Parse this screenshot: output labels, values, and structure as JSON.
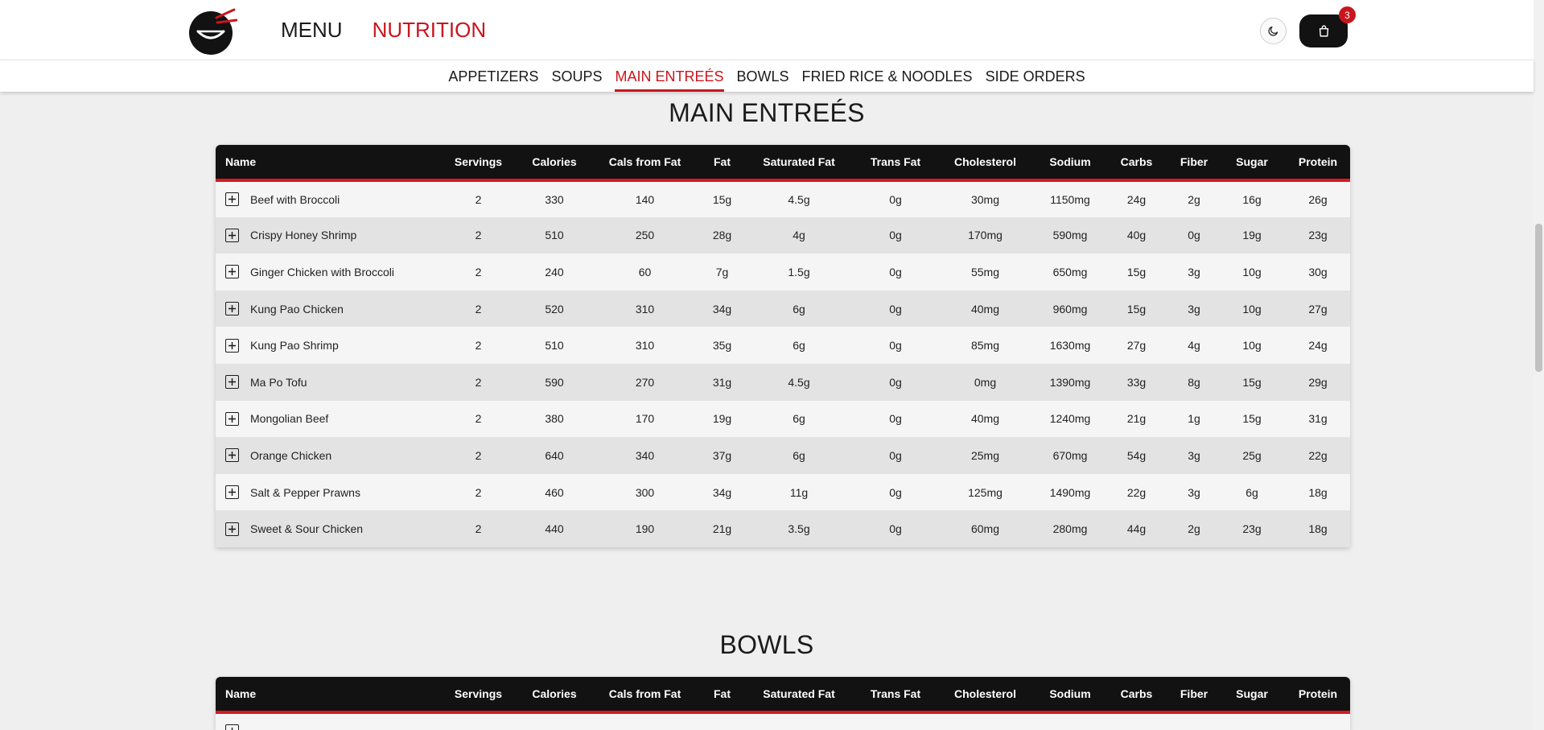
{
  "header": {
    "logo_icon": "bowl-chopsticks-logo",
    "nav": [
      {
        "label": "MENU",
        "active": false
      },
      {
        "label": "NUTRITION",
        "active": true
      }
    ],
    "theme_icon": "moon-icon",
    "cart_icon": "shopping-bag-icon",
    "cart_count": "3"
  },
  "subnav": [
    {
      "label": "APPETIZERS",
      "active": false
    },
    {
      "label": "SOUPS",
      "active": false
    },
    {
      "label": "MAIN ENTREÉS",
      "active": true
    },
    {
      "label": "BOWLS",
      "active": false
    },
    {
      "label": "FRIED RICE & NOODLES",
      "active": false
    },
    {
      "label": "SIDE ORDERS",
      "active": false
    }
  ],
  "columns": [
    "Name",
    "Servings",
    "Calories",
    "Cals from Fat",
    "Fat",
    "Saturated Fat",
    "Trans Fat",
    "Cholesterol",
    "Sodium",
    "Carbs",
    "Fiber",
    "Sugar",
    "Protein"
  ],
  "sections": [
    {
      "title": "MAIN ENTREÉS",
      "rows": [
        [
          "Beef with Broccoli",
          "2",
          "330",
          "140",
          "15g",
          "4.5g",
          "0g",
          "30mg",
          "1150mg",
          "24g",
          "2g",
          "16g",
          "26g"
        ],
        [
          "Crispy Honey Shrimp",
          "2",
          "510",
          "250",
          "28g",
          "4g",
          "0g",
          "170mg",
          "590mg",
          "40g",
          "0g",
          "19g",
          "23g"
        ],
        [
          "Ginger Chicken with Broccoli",
          "2",
          "240",
          "60",
          "7g",
          "1.5g",
          "0g",
          "55mg",
          "650mg",
          "15g",
          "3g",
          "10g",
          "30g"
        ],
        [
          "Kung Pao Chicken",
          "2",
          "520",
          "310",
          "34g",
          "6g",
          "0g",
          "40mg",
          "960mg",
          "15g",
          "3g",
          "10g",
          "27g"
        ],
        [
          "Kung Pao Shrimp",
          "2",
          "510",
          "310",
          "35g",
          "6g",
          "0g",
          "85mg",
          "1630mg",
          "27g",
          "4g",
          "10g",
          "24g"
        ],
        [
          "Ma Po Tofu",
          "2",
          "590",
          "270",
          "31g",
          "4.5g",
          "0g",
          "0mg",
          "1390mg",
          "33g",
          "8g",
          "15g",
          "29g"
        ],
        [
          "Mongolian Beef",
          "2",
          "380",
          "170",
          "19g",
          "6g",
          "0g",
          "40mg",
          "1240mg",
          "21g",
          "1g",
          "15g",
          "31g"
        ],
        [
          "Orange Chicken",
          "2",
          "640",
          "340",
          "37g",
          "6g",
          "0g",
          "25mg",
          "670mg",
          "54g",
          "3g",
          "25g",
          "22g"
        ],
        [
          "Salt & Pepper Prawns",
          "2",
          "460",
          "300",
          "34g",
          "11g",
          "0g",
          "125mg",
          "1490mg",
          "22g",
          "3g",
          "6g",
          "18g"
        ],
        [
          "Sweet & Sour Chicken",
          "2",
          "440",
          "190",
          "21g",
          "3.5g",
          "0g",
          "60mg",
          "280mg",
          "44g",
          "2g",
          "23g",
          "18g"
        ]
      ]
    },
    {
      "title": "BOWLS",
      "rows": []
    }
  ]
}
